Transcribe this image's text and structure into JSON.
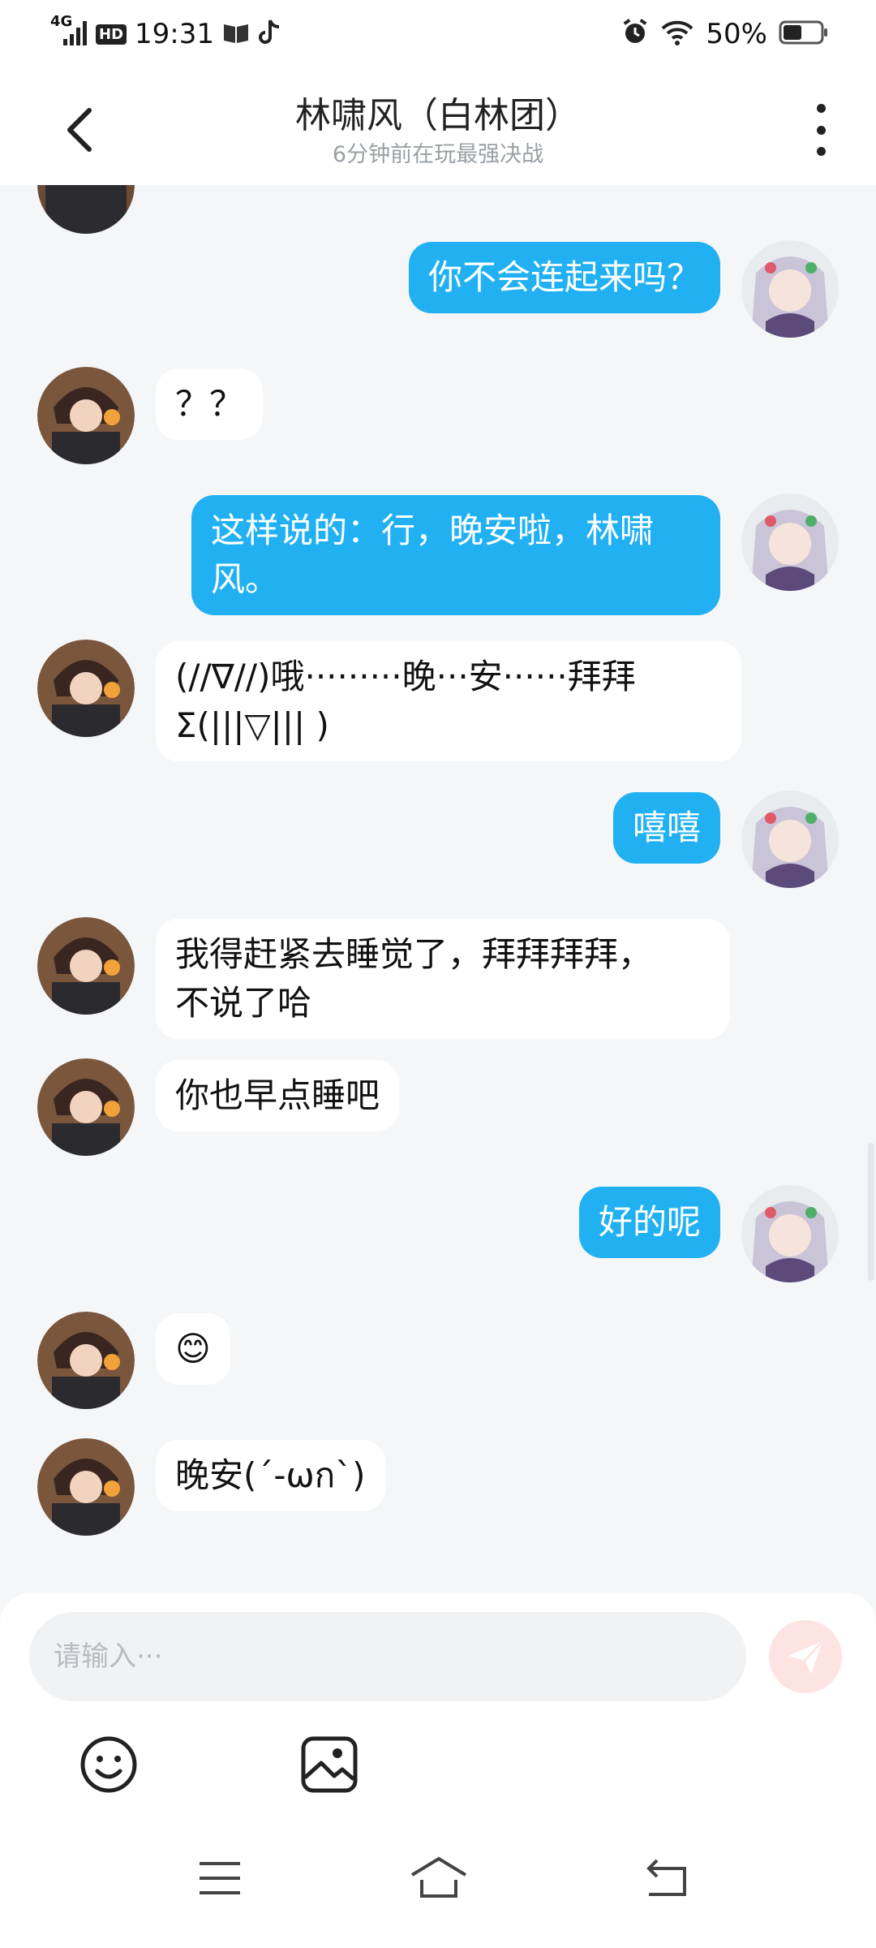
{
  "status_bar": {
    "network": "4G",
    "hd": "HD",
    "time": "19:31",
    "battery": "50%",
    "icons": [
      "signal-icon",
      "book-icon",
      "tiktok-icon",
      "alarm-icon",
      "wifi-icon",
      "battery-icon"
    ]
  },
  "header": {
    "title": "林啸风（白林团）",
    "subtitle": "6分钟前在玩最强决战"
  },
  "messages": [
    {
      "side": "out",
      "text": "你不会连起来吗？"
    },
    {
      "side": "in",
      "text": "？？"
    },
    {
      "side": "out",
      "lines": [
        "这样说的：行，晚安啦，林啸",
        "风。"
      ]
    },
    {
      "side": "in",
      "lines": [
        "(//∇//)哦·········晚···安······拜拜",
        "Σ(|||▽||| )"
      ]
    },
    {
      "side": "out",
      "text": "嘻嘻"
    },
    {
      "side": "in",
      "lines": [
        "我得赶紧去睡觉了，拜拜拜拜，",
        "不说了哈"
      ]
    },
    {
      "side": "in",
      "text": "你也早点睡吧"
    },
    {
      "side": "out",
      "text": "好的呢"
    },
    {
      "side": "in",
      "text": "😊"
    },
    {
      "side": "in",
      "text": "晚安(´-ωก`)"
    }
  ],
  "input": {
    "placeholder": "请输入···"
  },
  "colors": {
    "out_bubble": "#21b1f3",
    "in_bubble": "#ffffff",
    "background": "#f4f6f8",
    "send_button": "#fde4e2"
  },
  "toolbar_icons": [
    "emoji-icon",
    "image-icon"
  ],
  "nav_icons": [
    "menu-icon",
    "home-icon",
    "back-icon"
  ]
}
